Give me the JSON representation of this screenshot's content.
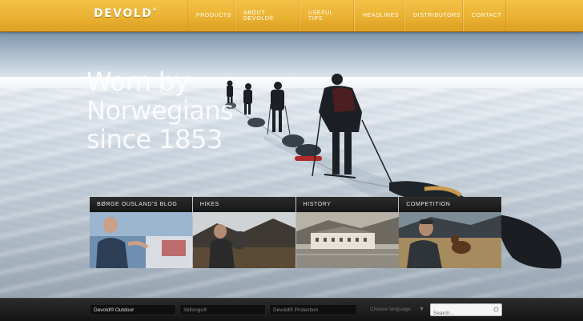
{
  "brand": {
    "name": "DEVOLD",
    "mark": "®"
  },
  "nav": {
    "items": [
      {
        "label": "PRODUCTS"
      },
      {
        "label": "ABOUT DEVOLD®"
      },
      {
        "label": "USEFUL TIPS"
      },
      {
        "label": "HEADLINES"
      },
      {
        "label": "DISTRIBUTORS"
      },
      {
        "label": "CONTACT"
      }
    ]
  },
  "hero": {
    "lines": [
      "Worn by",
      "Norwegians",
      "since 1853"
    ]
  },
  "tiles": [
    {
      "title": "BØRGE OUSLAND'S BLOG"
    },
    {
      "title": "HIKES"
    },
    {
      "title": "HISTORY"
    },
    {
      "title": "COMPETITION"
    }
  ],
  "footer": {
    "brands": [
      "Devold® Outdoor",
      "Stillongs®",
      "Devold® Protection"
    ],
    "language_placeholder": "Choose language",
    "search_placeholder": "Search...",
    "search_value": ""
  },
  "icons": {
    "search": "search-icon",
    "dropdown": "chevron-down-icon"
  },
  "colors": {
    "accent": "#eab232",
    "nav_text": "#ffffff",
    "tile_bg": "#1e1e1e",
    "footer_bg": "#1f1f1f"
  }
}
